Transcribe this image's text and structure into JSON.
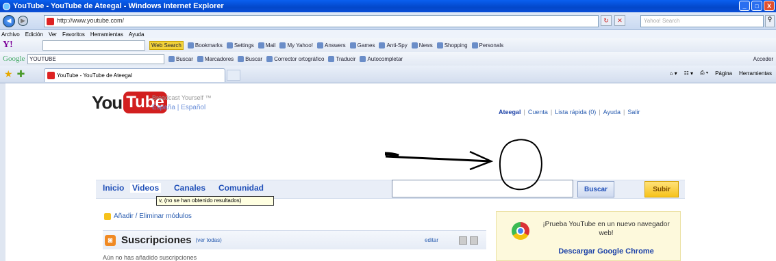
{
  "window": {
    "title": "YouTube - YouTube de Ateegal - Windows Internet Explorer",
    "min": "_",
    "max": "□",
    "close": "X"
  },
  "address": {
    "url": "http://www.youtube.com/",
    "search_placeholder": "Yahoo! Search"
  },
  "menu": [
    "Archivo",
    "Edición",
    "Ver",
    "Favoritos",
    "Herramientas",
    "Ayuda"
  ],
  "yahoo": {
    "logo": "Y!",
    "websearch": "Web Search",
    "items": [
      "Bookmarks",
      "Settings",
      "Mail",
      "My Yahoo!",
      "Answers",
      "Games",
      "Anti-Spy",
      "News",
      "Shopping",
      "Personals"
    ]
  },
  "google": {
    "logo": "Google",
    "input": "YOUTUBE",
    "items": [
      "Buscar",
      "Marcadores",
      "Buscar",
      "Corrector ortográfico",
      "Traducir",
      "Autocompletar"
    ],
    "right": "Acceder"
  },
  "tab": {
    "title": "YouTube - YouTube de Ateegal"
  },
  "cmd": {
    "pagina": "Página",
    "herramientas": "Herramientas"
  },
  "yt": {
    "you": "You",
    "tube": "Tube",
    "slogan": "Broadcast Yourself ™",
    "region": "España | Español"
  },
  "user": {
    "name": "Ateegal",
    "links": [
      "Cuenta",
      "Lista rápida (0)",
      "Ayuda",
      "Salir"
    ]
  },
  "nav": [
    "Inicio",
    "Videos",
    "Canales",
    "Comunidad"
  ],
  "tooltip": "v, (no se han obtenido resultados)",
  "search": {
    "value": "",
    "button": "Buscar",
    "upload": "Subir"
  },
  "modules": "Añadir / Eliminar módulos",
  "subs": {
    "title": "Suscripciones",
    "ver": "(ver todas)",
    "editar": "editar",
    "empty": "Aún no has añadido suscripciones"
  },
  "chrome": {
    "text": "¡Prueba YouTube en un nuevo navegador web!",
    "link": "Descargar Google Chrome"
  }
}
